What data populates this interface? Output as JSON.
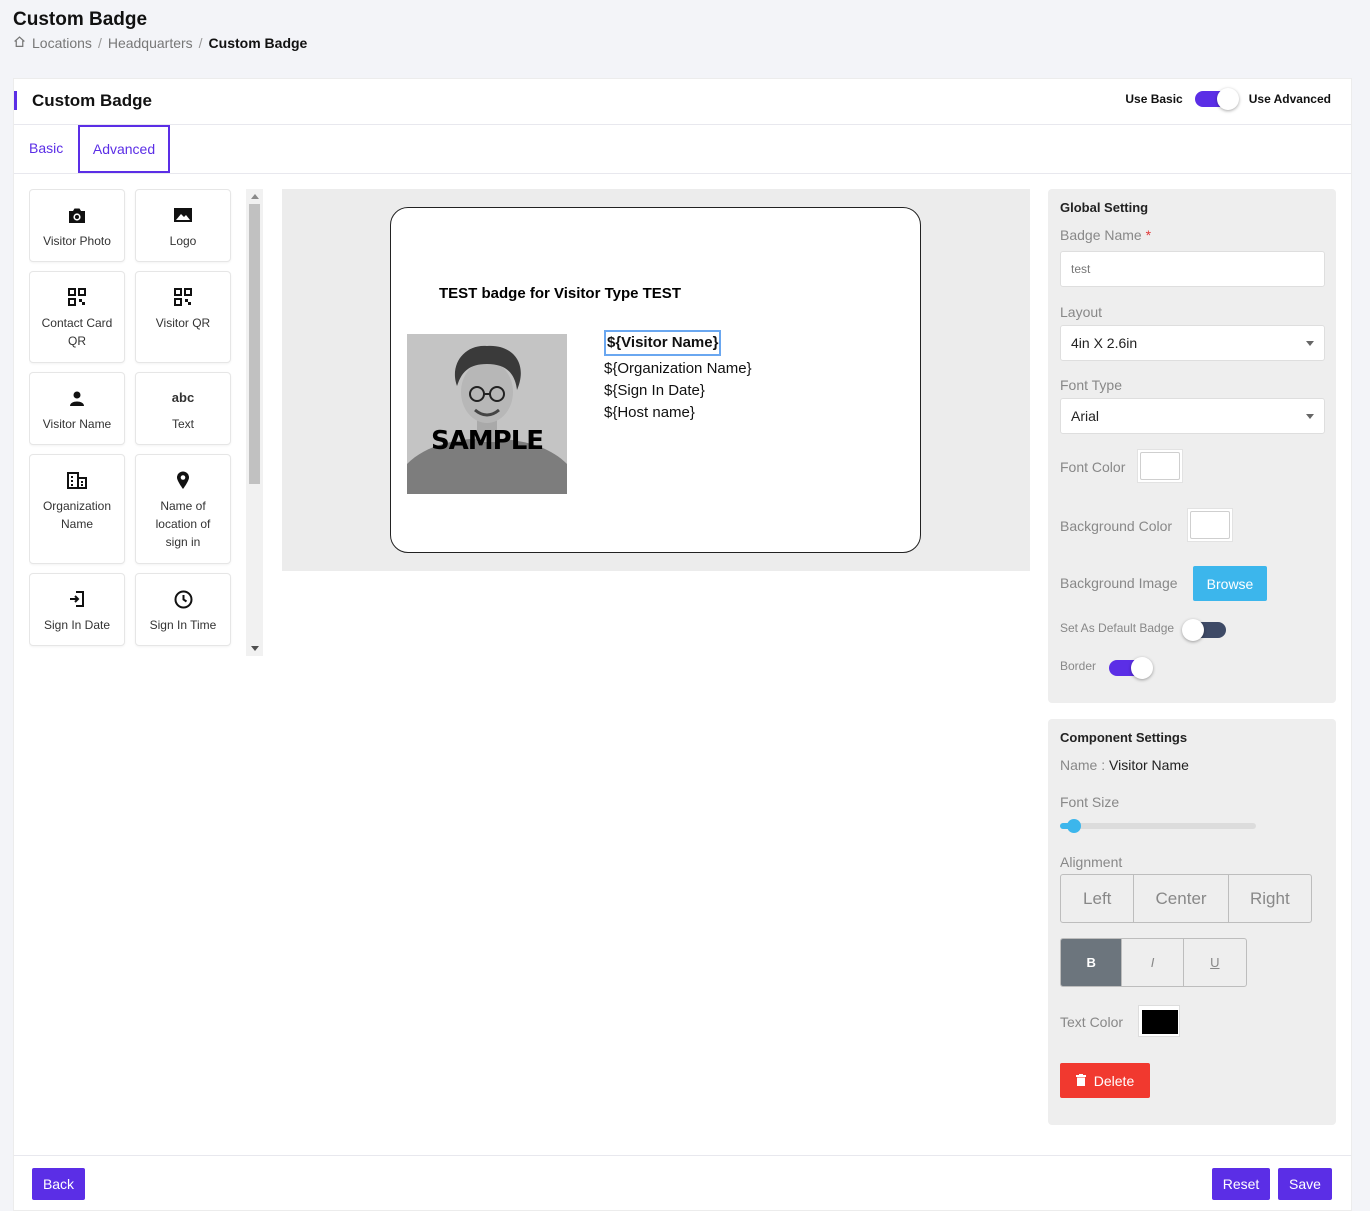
{
  "page": {
    "title": "Custom Badge",
    "breadcrumb": [
      "Locations",
      "Headquarters",
      "Custom Badge"
    ],
    "separator": "/"
  },
  "card": {
    "title": "Custom Badge",
    "mode_basic": "Use Basic",
    "mode_advanced": "Use Advanced",
    "mode_is_advanced": true
  },
  "tabs": {
    "basic": "Basic",
    "advanced": "Advanced",
    "active": "Advanced"
  },
  "palette": [
    {
      "label": "Visitor Photo",
      "icon": "camera-icon"
    },
    {
      "label": "Logo",
      "icon": "image-icon"
    },
    {
      "label": "Contact Card QR",
      "icon": "qr-code-icon"
    },
    {
      "label": "Visitor QR",
      "icon": "qr-code-icon"
    },
    {
      "label": "Visitor Name",
      "icon": "person-icon"
    },
    {
      "label": "Text",
      "icon": "text-abc-icon",
      "glyph": "abc"
    },
    {
      "label": "Organization Name",
      "icon": "building-icon"
    },
    {
      "label": "Name of location of sign in",
      "icon": "location-pin-icon"
    },
    {
      "label": "Sign In Date",
      "icon": "sign-in-icon"
    },
    {
      "label": "Sign In Time",
      "icon": "clock-icon"
    }
  ],
  "badge": {
    "title": "TEST badge for Visitor Type TEST",
    "photo_label": "SAMPLE",
    "fields": [
      "${Visitor Name}",
      "${Organization Name}",
      "${Sign In Date}",
      "${Host name}"
    ],
    "selected_field": "${Visitor Name}"
  },
  "global_setting": {
    "title": "Global Setting",
    "badge_name_label": "Badge Name",
    "required_mark": "*",
    "badge_name_value": "test",
    "layout_label": "Layout",
    "layout_value": "4in X 2.6in",
    "font_type_label": "Font Type",
    "font_type_value": "Arial",
    "font_color_label": "Font Color",
    "font_color": "#ffffff",
    "background_color_label": "Background Color",
    "background_color": "#ffffff",
    "background_image_label": "Background Image",
    "browse_label": "Browse",
    "default_badge_label": "Set As Default Badge",
    "default_badge_on": false,
    "border_label": "Border",
    "border_on": true
  },
  "component_settings": {
    "title": "Component Settings",
    "name_label": "Name :",
    "name_value": "Visitor Name",
    "font_size_label": "Font Size",
    "font_size_fraction": 0.07,
    "alignment_label": "Alignment",
    "alignment_options": [
      "Left",
      "Center",
      "Right"
    ],
    "style_options": [
      "B",
      "I",
      "U"
    ],
    "active_style": "B",
    "text_color_label": "Text Color",
    "text_color": "#000000",
    "delete_label": "Delete"
  },
  "footer": {
    "back": "Back",
    "reset": "Reset",
    "save": "Save"
  },
  "colors": {
    "accent": "#5b2ee6",
    "info": "#3cb6ec",
    "danger": "#f1392f"
  }
}
